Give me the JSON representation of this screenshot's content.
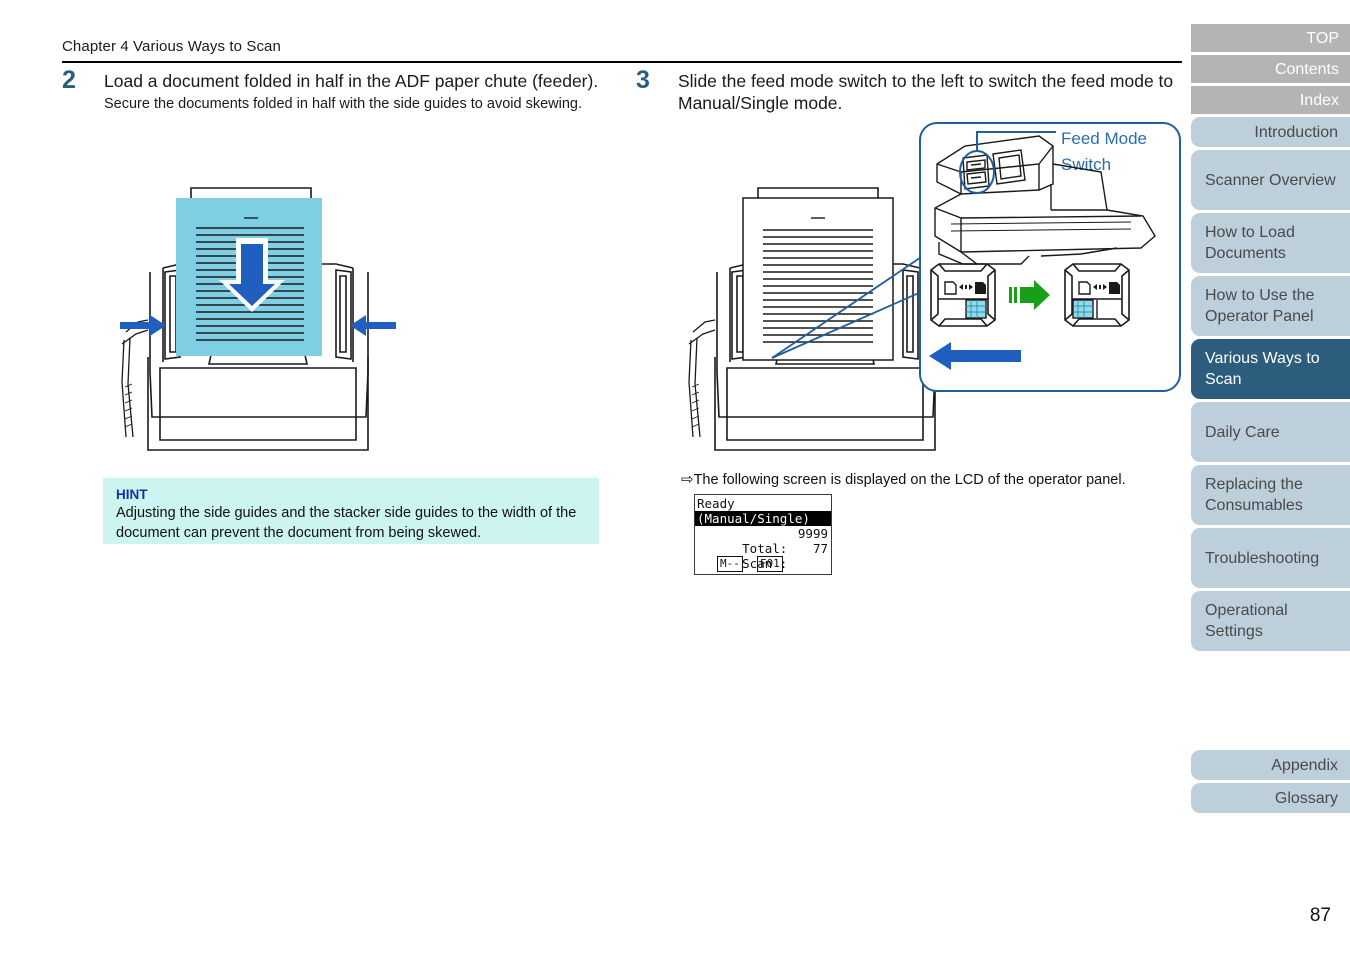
{
  "header": {
    "chapter": "Chapter 4 Various Ways to Scan"
  },
  "steps": [
    {
      "number": "2",
      "title": "Load a document folded in half in the ADF paper chute (feeder).",
      "subtext": "Secure the documents folded in half with the side guides to avoid skewing."
    },
    {
      "number": "3",
      "title": "Slide the feed mode switch to the left to switch the feed mode to Manual/Single mode."
    }
  ],
  "hint": {
    "title": "HINT",
    "text": "Adjusting the side guides and the stacker side guides to the width of the document can prevent the document from being skewed."
  },
  "callout": {
    "label_line1": "Feed Mode",
    "label_line2": "Switch"
  },
  "lcd_note": {
    "arrow": "⇨",
    "text": "The following screen is displayed on the LCD of the operator panel."
  },
  "lcd": {
    "line1": "Ready",
    "line2": "(Manual/Single)",
    "line3_label": "Total:",
    "line3_value": "9999",
    "line4_label": "Scan :",
    "line4_value": "77",
    "button1": "M--",
    "button2": "F01"
  },
  "sidebar": {
    "top_tabs": [
      {
        "label": "TOP"
      },
      {
        "label": "Contents"
      },
      {
        "label": "Index"
      }
    ],
    "nav_tabs": [
      {
        "label": "Introduction",
        "lines": 1,
        "active": false,
        "align": "left"
      },
      {
        "label": "Scanner Overview",
        "lines": 2,
        "active": false,
        "align": "left"
      },
      {
        "label": "How to Load Documents",
        "lines": 2,
        "active": false,
        "align": "left"
      },
      {
        "label": "How to Use the Operator Panel",
        "lines": 2,
        "active": false,
        "align": "left"
      },
      {
        "label": "Various Ways to Scan",
        "lines": 2,
        "active": true,
        "align": "left"
      },
      {
        "label": "Daily Care",
        "lines": 2,
        "active": false,
        "align": "left"
      },
      {
        "label": "Replacing the Consumables",
        "lines": 2,
        "active": false,
        "align": "left"
      },
      {
        "label": "Troubleshooting",
        "lines": 2,
        "active": false,
        "align": "left"
      },
      {
        "label": "Operational Settings",
        "lines": 2,
        "active": false,
        "align": "left"
      }
    ],
    "bottom_tabs": [
      {
        "label": "Appendix"
      },
      {
        "label": "Glossary"
      }
    ]
  },
  "page_number": "87",
  "colors": {
    "accent_dark_blue": "#2d5d7d",
    "tab_blue": "#bdcfdb",
    "tab_gray": "#b4b4b4",
    "hint_bg": "#ccf4f0",
    "hint_title": "#1330b0",
    "callout_border": "#1f5f9e",
    "document_fill": "#7fcfe4",
    "arrow_blue": "#1f5fbf",
    "arrow_green": "#17a017"
  }
}
